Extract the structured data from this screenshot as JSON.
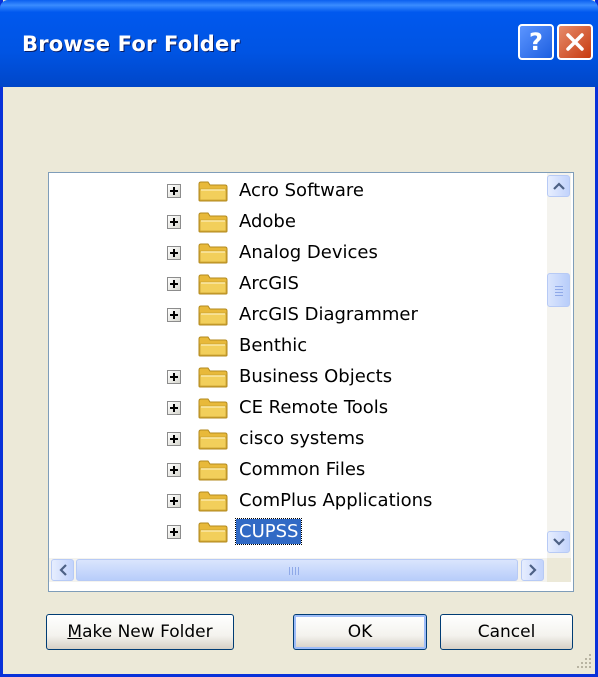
{
  "window": {
    "title": "Browse For Folder"
  },
  "titlebar": {
    "help_glyph": "?",
    "close_icon": "close-x-icon"
  },
  "tree": {
    "items": [
      {
        "label": "Acro Software",
        "expandable": true,
        "selected": false
      },
      {
        "label": "Adobe",
        "expandable": true,
        "selected": false
      },
      {
        "label": "Analog Devices",
        "expandable": true,
        "selected": false
      },
      {
        "label": "ArcGIS",
        "expandable": true,
        "selected": false
      },
      {
        "label": "ArcGIS Diagrammer",
        "expandable": true,
        "selected": false
      },
      {
        "label": "Benthic",
        "expandable": false,
        "selected": false
      },
      {
        "label": "Business Objects",
        "expandable": true,
        "selected": false
      },
      {
        "label": "CE Remote Tools",
        "expandable": true,
        "selected": false
      },
      {
        "label": "cisco systems",
        "expandable": true,
        "selected": false
      },
      {
        "label": "Common Files",
        "expandable": true,
        "selected": false
      },
      {
        "label": "ComPlus Applications",
        "expandable": true,
        "selected": false
      },
      {
        "label": "CUPSS",
        "expandable": true,
        "selected": true
      }
    ]
  },
  "buttons": {
    "make_new_folder": {
      "prefix": "M",
      "rest": "ake New Folder"
    },
    "ok": "OK",
    "cancel": "Cancel"
  },
  "colors": {
    "titlebar": "#0054e3",
    "dialog_bg": "#ece9d8",
    "selection": "#316ac5",
    "folder_yellow": "#f2cf5b"
  }
}
